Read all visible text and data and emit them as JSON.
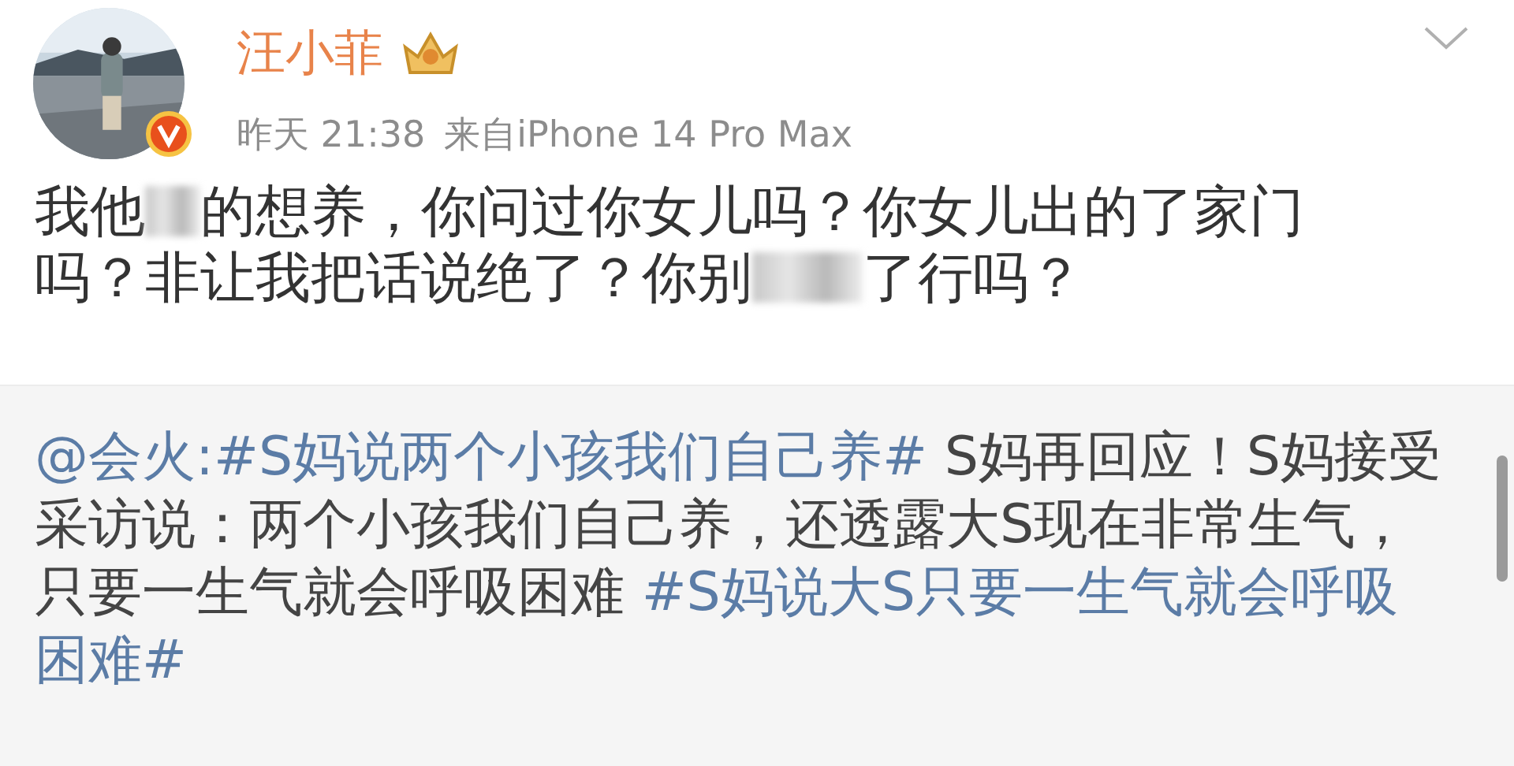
{
  "post": {
    "author": "汪小菲",
    "time": "昨天 21:38",
    "source": "来自iPhone 14 Pro Max",
    "avatar": {
      "kind": "picture",
      "verified": true
    },
    "content": [
      {
        "kind": "text",
        "text": "我他"
      },
      {
        "kind": "mosaic"
      },
      {
        "kind": "text",
        "text": "的想养，你问过你女儿吗？你女儿出的了家门吗？非让我把话说绝了？你别"
      },
      {
        "kind": "widemosaic"
      },
      {
        "kind": "text",
        "text": "了行吗？"
      }
    ]
  },
  "repost": {
    "content": [
      {
        "kind": "mention",
        "text": "@会火:"
      },
      {
        "kind": "topic",
        "text": "#S妈说两个小孩我们自己养#"
      },
      {
        "kind": "text",
        "text": " S妈再回应！S妈接受采访说：两个小孩我们自己养，还透露大S现在非常生气，只要一生气就会呼吸困难 "
      },
      {
        "kind": "topic",
        "text": "#S妈说大S只要一生气就会呼吸困难#"
      }
    ]
  }
}
